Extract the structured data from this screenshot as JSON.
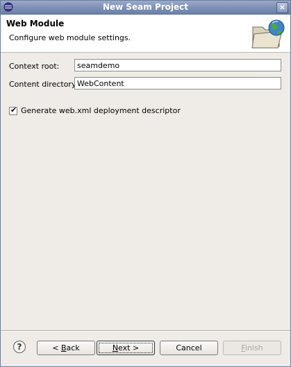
{
  "window": {
    "title": "New Seam Project"
  },
  "header": {
    "heading": "Web Module",
    "description": "Configure web module settings."
  },
  "form": {
    "context_root_label": "Context root:",
    "context_root_value": "seamdemo",
    "content_dir_label": "Content directory:",
    "content_dir_value": "WebContent",
    "generate_checkbox_label": "Generate web.xml deployment descriptor",
    "generate_checked": true
  },
  "buttons": {
    "help_glyph": "?",
    "back_prefix": "< ",
    "back_mnemonic": "B",
    "back_rest": "ack",
    "next_mnemonic": "N",
    "next_rest": "ext >",
    "cancel": "Cancel",
    "finish_mnemonic": "F",
    "finish_rest": "inish"
  },
  "icons": {
    "app": "eclipse-app-icon",
    "banner": "folder-globe-icon",
    "close": "close-icon",
    "help": "help-icon"
  }
}
